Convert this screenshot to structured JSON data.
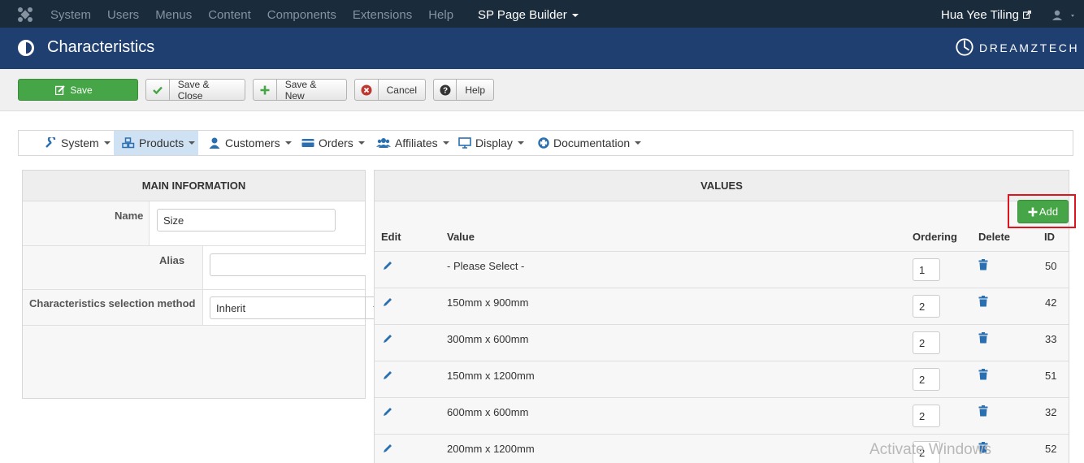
{
  "topbar": {
    "menu": [
      "System",
      "Users",
      "Menus",
      "Content",
      "Components",
      "Extensions",
      "Help"
    ],
    "page_builder": "SP Page Builder",
    "user_name": "Hua Yee Tiling"
  },
  "header": {
    "title": "Characteristics",
    "brand": "DREAMZTECH"
  },
  "toolbar": {
    "save": "Save",
    "save_close": "Save & Close",
    "save_new": "Save & New",
    "cancel": "Cancel",
    "help": "Help"
  },
  "nav": {
    "items": [
      "System",
      "Products",
      "Customers",
      "Orders",
      "Affiliates",
      "Display",
      "Documentation"
    ],
    "active": "Products"
  },
  "main_info": {
    "heading": "MAIN INFORMATION",
    "name_label": "Name",
    "name_value": "Size",
    "alias_label": "Alias",
    "alias_value": "",
    "method_label": "Characteristics selection method",
    "method_value": "Inherit"
  },
  "values": {
    "heading": "VALUES",
    "add_label": "Add",
    "columns": {
      "edit": "Edit",
      "value": "Value",
      "ordering": "Ordering",
      "delete": "Delete",
      "id": "ID"
    },
    "rows": [
      {
        "value": "- Please Select -",
        "ordering": "1",
        "id": "50"
      },
      {
        "value": "150mm x 900mm",
        "ordering": "2",
        "id": "42"
      },
      {
        "value": "300mm x 600mm",
        "ordering": "2",
        "id": "33"
      },
      {
        "value": "150mm x 1200mm",
        "ordering": "2",
        "id": "51"
      },
      {
        "value": "600mm x 600mm",
        "ordering": "2",
        "id": "32"
      },
      {
        "value": "200mm x 1200mm",
        "ordering": "2",
        "id": "52"
      }
    ]
  },
  "watermark": "Activate Windows",
  "colors": {
    "accent_green": "#46a546",
    "header_blue": "#1e3f6f",
    "topbar": "#1a2b3c",
    "icon_blue": "#2a6fb0",
    "highlight_red": "#e0141e"
  }
}
